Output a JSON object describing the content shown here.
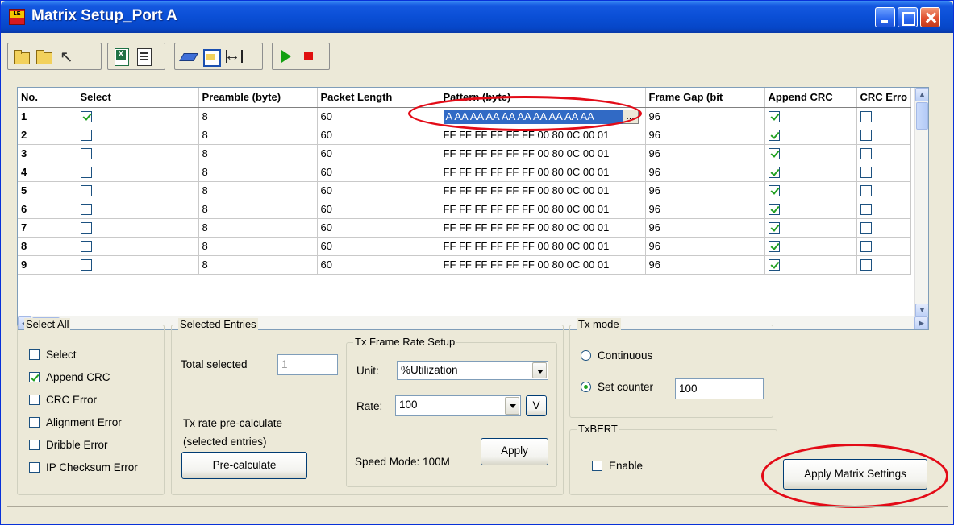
{
  "window": {
    "title": "Matrix Setup_Port A",
    "icon_text": "LE"
  },
  "grid": {
    "columns": [
      "No.",
      "Select",
      "Preamble (byte)",
      "Packet Length",
      "Pattern (byte)",
      "Frame Gap (bit",
      "Append CRC",
      "CRC Erro"
    ],
    "editing_pattern": "A AA AA AA AA AA AA AA AA AA",
    "editor_button": "...",
    "rows": [
      {
        "no": "1",
        "select": true,
        "preamble": "8",
        "length": "60",
        "pattern": "",
        "gap": "96",
        "append_crc": true,
        "crc_error": false
      },
      {
        "no": "2",
        "select": false,
        "preamble": "8",
        "length": "60",
        "pattern": "FF FF FF FF FF FF 00 80 0C 00 01",
        "gap": "96",
        "append_crc": true,
        "crc_error": false
      },
      {
        "no": "3",
        "select": false,
        "preamble": "8",
        "length": "60",
        "pattern": "FF FF FF FF FF FF 00 80 0C 00 01",
        "gap": "96",
        "append_crc": true,
        "crc_error": false
      },
      {
        "no": "4",
        "select": false,
        "preamble": "8",
        "length": "60",
        "pattern": "FF FF FF FF FF FF 00 80 0C 00 01",
        "gap": "96",
        "append_crc": true,
        "crc_error": false
      },
      {
        "no": "5",
        "select": false,
        "preamble": "8",
        "length": "60",
        "pattern": "FF FF FF FF FF FF 00 80 0C 00 01",
        "gap": "96",
        "append_crc": true,
        "crc_error": false
      },
      {
        "no": "6",
        "select": false,
        "preamble": "8",
        "length": "60",
        "pattern": "FF FF FF FF FF FF 00 80 0C 00 01",
        "gap": "96",
        "append_crc": true,
        "crc_error": false
      },
      {
        "no": "7",
        "select": false,
        "preamble": "8",
        "length": "60",
        "pattern": "FF FF FF FF FF FF 00 80 0C 00 01",
        "gap": "96",
        "append_crc": true,
        "crc_error": false
      },
      {
        "no": "8",
        "select": false,
        "preamble": "8",
        "length": "60",
        "pattern": "FF FF FF FF FF FF 00 80 0C 00 01",
        "gap": "96",
        "append_crc": true,
        "crc_error": false
      },
      {
        "no": "9",
        "select": false,
        "preamble": "8",
        "length": "60",
        "pattern": "FF FF FF FF FF FF 00 80 0C 00 01",
        "gap": "96",
        "append_crc": true,
        "crc_error": false
      }
    ]
  },
  "select_all": {
    "title": "Select All",
    "items": [
      {
        "label": "Select",
        "checked": false
      },
      {
        "label": "Append CRC",
        "checked": true
      },
      {
        "label": "CRC Error",
        "checked": false
      },
      {
        "label": "Alignment Error",
        "checked": false
      },
      {
        "label": "Dribble Error",
        "checked": false
      },
      {
        "label": "IP Checksum Error",
        "checked": false
      }
    ]
  },
  "selected_entries": {
    "title": "Selected Entries",
    "total_label": "Total selected",
    "total_value": "1",
    "precalc_label_1": "Tx rate pre-calculate",
    "precalc_label_2": "(selected entries)",
    "precalc_button": "Pre-calculate"
  },
  "tx_frame_rate": {
    "title": "Tx Frame Rate Setup",
    "unit_label": "Unit:",
    "unit_value": "%Utilization",
    "rate_label": "Rate:",
    "rate_value": "100",
    "v_button": "V",
    "speed_mode": "Speed Mode: 100M",
    "apply_button": "Apply"
  },
  "tx_mode": {
    "title": "Tx mode",
    "continuous_label": "Continuous",
    "set_counter_label": "Set counter",
    "counter_value": "100",
    "selected": "set_counter"
  },
  "txbert": {
    "title": "TxBERT",
    "enable_label": "Enable",
    "enabled": false
  },
  "apply_matrix_button": "Apply Matrix Settings",
  "colors": {
    "highlight": "#316ac5",
    "check": "#21a121",
    "annotation": "#e30b17",
    "titlebar": "#0a4fd6"
  }
}
